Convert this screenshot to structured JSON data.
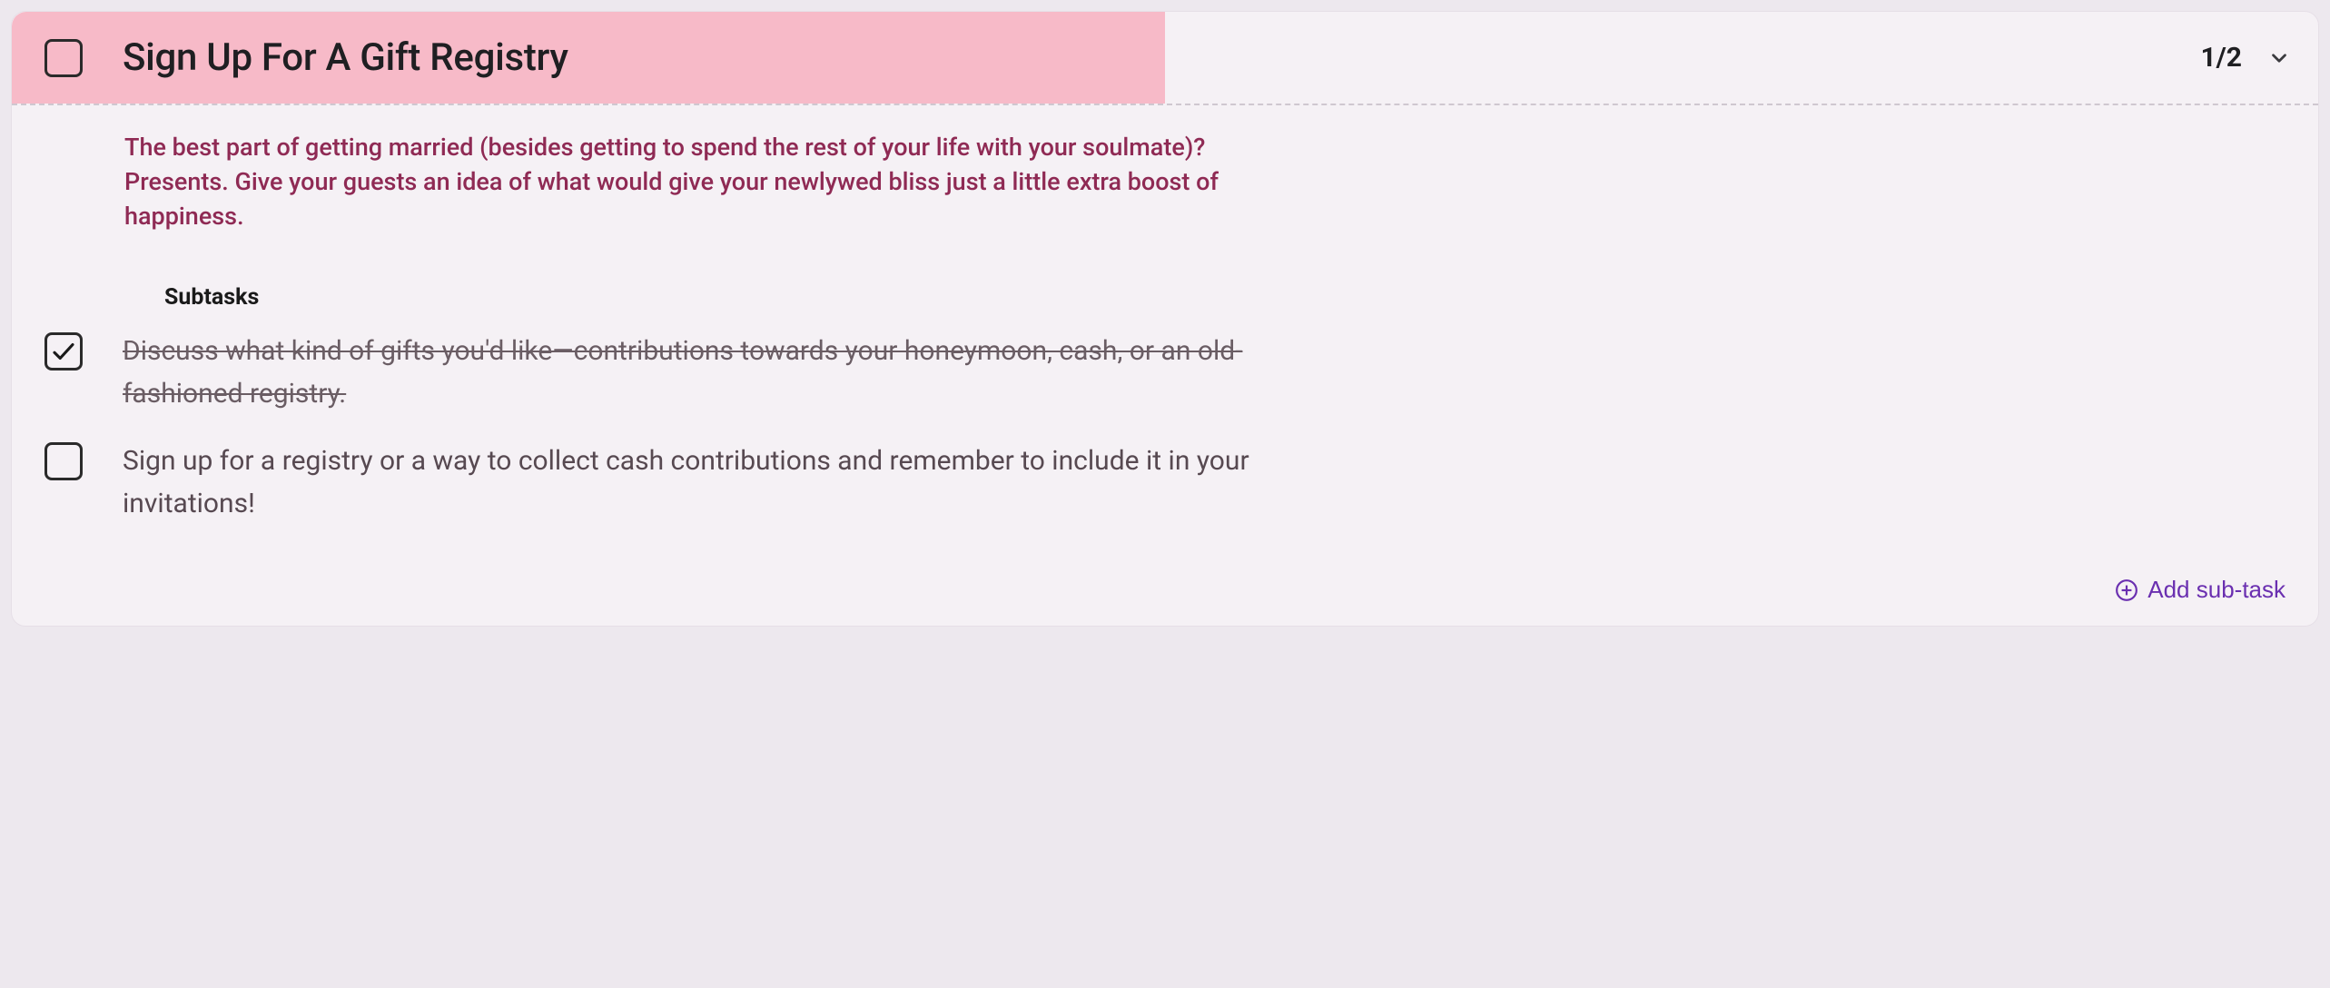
{
  "task": {
    "title": "Sign Up For A Gift Registry",
    "counter": "1/2",
    "description": "The best part of getting married (besides getting to spend the rest of your life with your soulmate)? Presents. Give your guests an idea of what would give your newlywed bliss just a little extra boost of happiness.",
    "subtasks_heading": "Subtasks",
    "subtasks": [
      {
        "label": "Discuss what kind of gifts you'd like—contributions towards your honeymoon, cash, or an old-fashioned registry.",
        "completed": true
      },
      {
        "label": "Sign up for a registry or a way to collect cash contributions and remember to include it in your invitations!",
        "completed": false
      }
    ],
    "add_subtask_label": "Add sub-task"
  }
}
